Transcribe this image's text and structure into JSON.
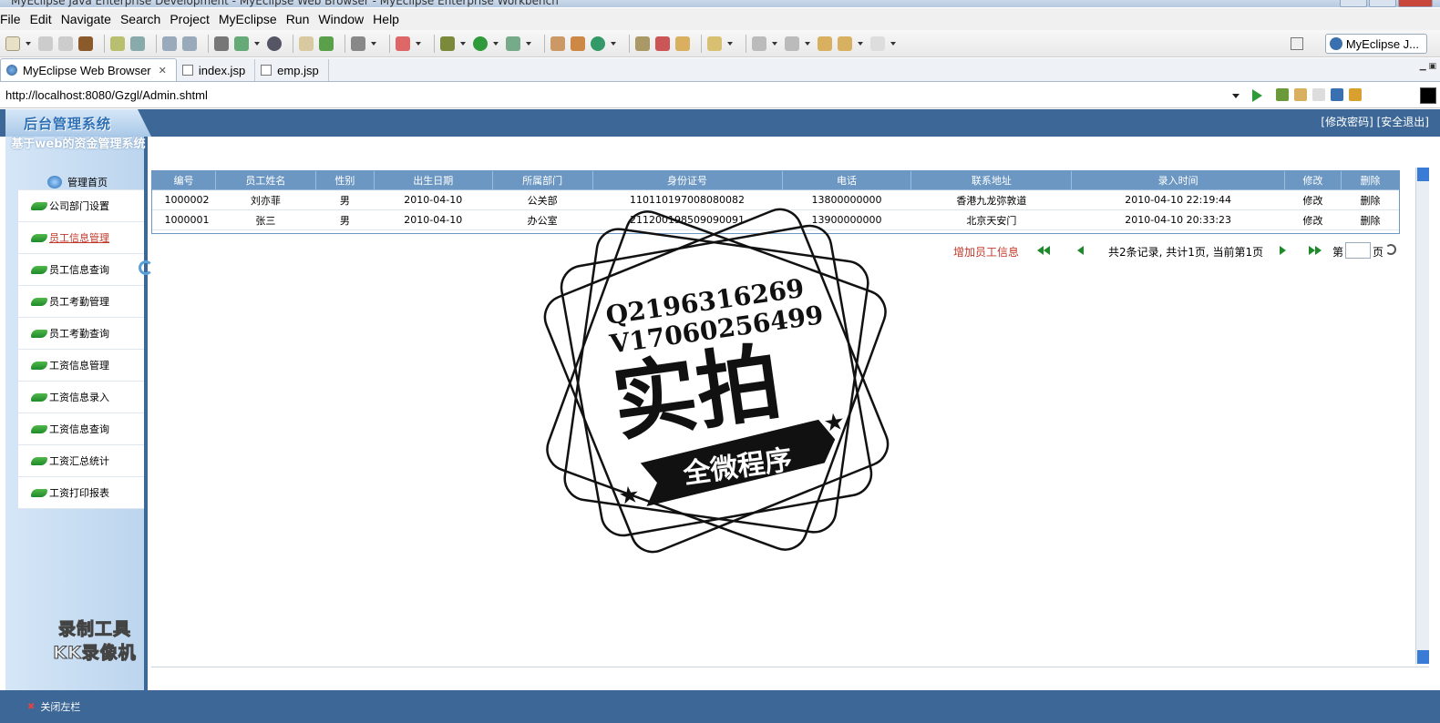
{
  "window": {
    "title": "MyEclipse Java Enterprise Development - MyEclipse Web Browser - MyEclipse Enterprise Workbench"
  },
  "menu": [
    "File",
    "Edit",
    "Navigate",
    "Search",
    "Project",
    "MyEclipse",
    "Run",
    "Window",
    "Help"
  ],
  "perspective": {
    "label": "MyEclipse J..."
  },
  "tabs": [
    {
      "label": "MyEclipse Web Browser",
      "icon": "globe-icon",
      "active": true
    },
    {
      "label": "index.jsp",
      "icon": "jsp-file-icon",
      "active": false
    },
    {
      "label": "emp.jsp",
      "icon": "jsp-file-icon",
      "active": false
    }
  ],
  "browser": {
    "url": "http://localhost:8080/Gzgl/Admin.shtml"
  },
  "app": {
    "logo": "后台管理系统",
    "header_links": {
      "change_password": "[修改密码]",
      "logout": "[安全退出]"
    },
    "system_title": "基于web的资金管理系统",
    "home": "管理首页",
    "menu": [
      {
        "label": "公司部门设置",
        "active": false
      },
      {
        "label": "员工信息管理",
        "active": true
      },
      {
        "label": "员工信息查询",
        "active": false
      },
      {
        "label": "员工考勤管理",
        "active": false
      },
      {
        "label": "员工考勤查询",
        "active": false
      },
      {
        "label": "工资信息管理",
        "active": false
      },
      {
        "label": "工资信息录入",
        "active": false
      },
      {
        "label": "工资信息查询",
        "active": false
      },
      {
        "label": "工资汇总统计",
        "active": false
      },
      {
        "label": "工资打印报表",
        "active": false
      }
    ],
    "footer": {
      "close_sidebar": "关闭左栏"
    }
  },
  "table": {
    "headers": [
      "编号",
      "员工姓名",
      "性别",
      "出生日期",
      "所属部门",
      "身份证号",
      "电话",
      "联系地址",
      "录入时间",
      "修改",
      "删除"
    ],
    "rows": [
      [
        "1000002",
        "刘亦菲",
        "男",
        "2010-04-10",
        "公关部",
        "110110197008080082",
        "13800000000",
        "香港九龙弥敦道",
        "2010-04-10 22:19:44",
        "修改",
        "删除"
      ],
      [
        "1000001",
        "张三",
        "男",
        "2010-04-10",
        "办公室",
        "211200198509090091",
        "13900000000",
        "北京天安门",
        "2010-04-10 20:33:23",
        "修改",
        "删除"
      ]
    ]
  },
  "pager": {
    "add_label": "增加员工信息",
    "info": "共2条记录, 共计1页, 当前第1页",
    "page_prefix": "第",
    "page_suffix": "页"
  },
  "watermarks": {
    "recorder": [
      "录制工具",
      "KK录像机"
    ],
    "stamp": {
      "line1": "Q2196316269",
      "line2": "V17060256499",
      "main": "实拍",
      "banner": "全微程序"
    }
  }
}
